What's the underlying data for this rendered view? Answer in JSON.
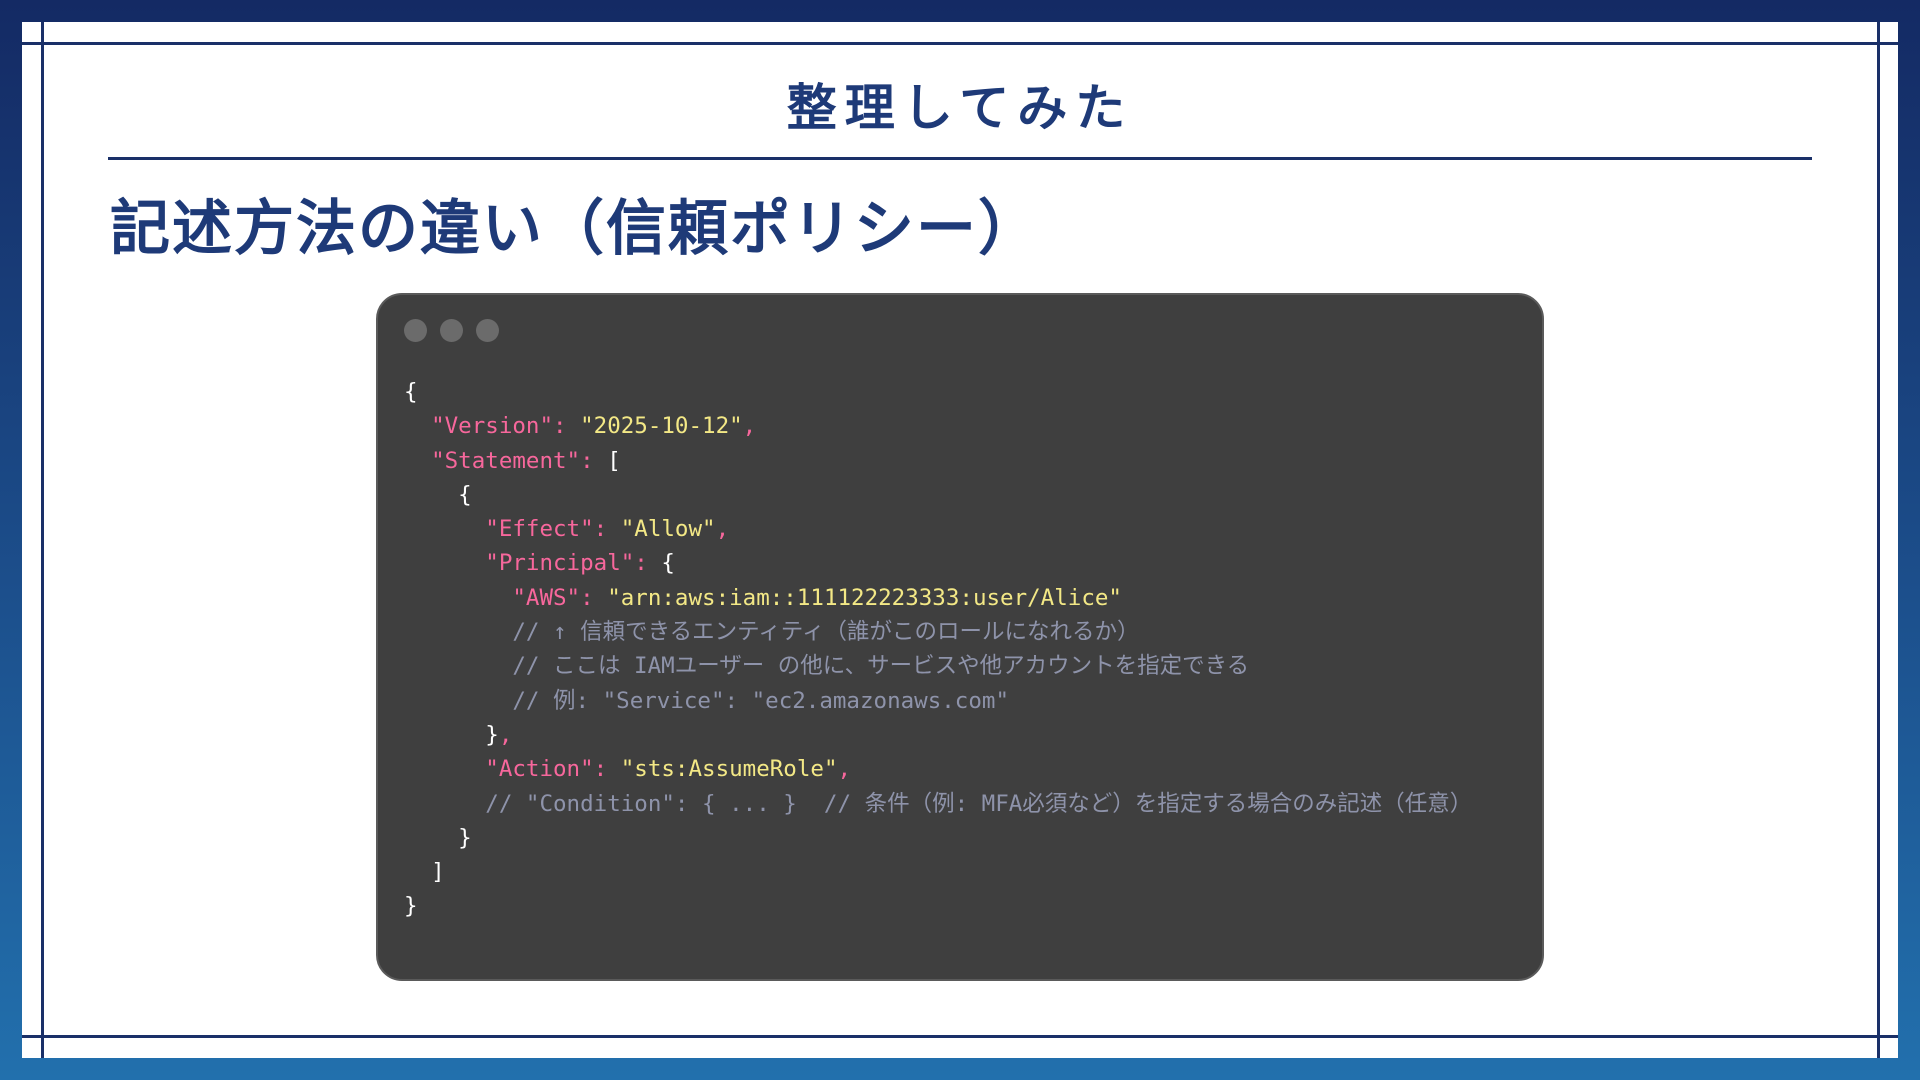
{
  "slide": {
    "header_title": "整理してみた",
    "section_title": "記述方法の違い（信頼ポリシー）"
  },
  "code_window": {
    "lines": [
      [
        {
          "t": "p",
          "v": "{"
        }
      ],
      [
        {
          "t": "p",
          "v": "  "
        },
        {
          "t": "k",
          "v": "\"Version\": "
        },
        {
          "t": "s",
          "v": "\"2025-10-12\""
        },
        {
          "t": "k",
          "v": ","
        }
      ],
      [
        {
          "t": "p",
          "v": "  "
        },
        {
          "t": "k",
          "v": "\"Statement\": "
        },
        {
          "t": "p",
          "v": "["
        }
      ],
      [
        {
          "t": "p",
          "v": "    {"
        }
      ],
      [
        {
          "t": "p",
          "v": "      "
        },
        {
          "t": "k",
          "v": "\"Effect\": "
        },
        {
          "t": "s",
          "v": "\"Allow\""
        },
        {
          "t": "k",
          "v": ","
        }
      ],
      [
        {
          "t": "p",
          "v": "      "
        },
        {
          "t": "k",
          "v": "\"Principal\": "
        },
        {
          "t": "p",
          "v": "{"
        }
      ],
      [
        {
          "t": "p",
          "v": "        "
        },
        {
          "t": "k",
          "v": "\"AWS\": "
        },
        {
          "t": "s",
          "v": "\"arn:aws:iam::111122223333:user/Alice\""
        }
      ],
      [
        {
          "t": "c",
          "v": "        // ↑ 信頼できるエンティティ（誰がこのロールになれるか）"
        }
      ],
      [
        {
          "t": "c",
          "v": "        // ここは IAMユーザー の他に、サービスや他アカウントを指定できる"
        }
      ],
      [
        {
          "t": "c",
          "v": "        // 例: \"Service\": \"ec2.amazonaws.com\""
        }
      ],
      [
        {
          "t": "p",
          "v": "      }"
        },
        {
          "t": "k",
          "v": ","
        }
      ],
      [
        {
          "t": "p",
          "v": "      "
        },
        {
          "t": "k",
          "v": "\"Action\": "
        },
        {
          "t": "s",
          "v": "\"sts:AssumeRole\""
        },
        {
          "t": "k",
          "v": ","
        }
      ],
      [
        {
          "t": "c",
          "v": "      // \"Condition\": { ... }  // 条件（例: MFA必須など）を指定する場合のみ記述（任意）"
        }
      ],
      [
        {
          "t": "p",
          "v": "    }"
        }
      ],
      [
        {
          "t": "p",
          "v": "  ]"
        }
      ],
      [
        {
          "t": "p",
          "v": "}"
        }
      ]
    ]
  },
  "colors": {
    "key": "#f7679c",
    "string": "#f3e886",
    "punctuation": "#ffffff",
    "comment": "#8e93aa",
    "title": "#1e3a78",
    "editor_bg": "#3f3f3f"
  }
}
